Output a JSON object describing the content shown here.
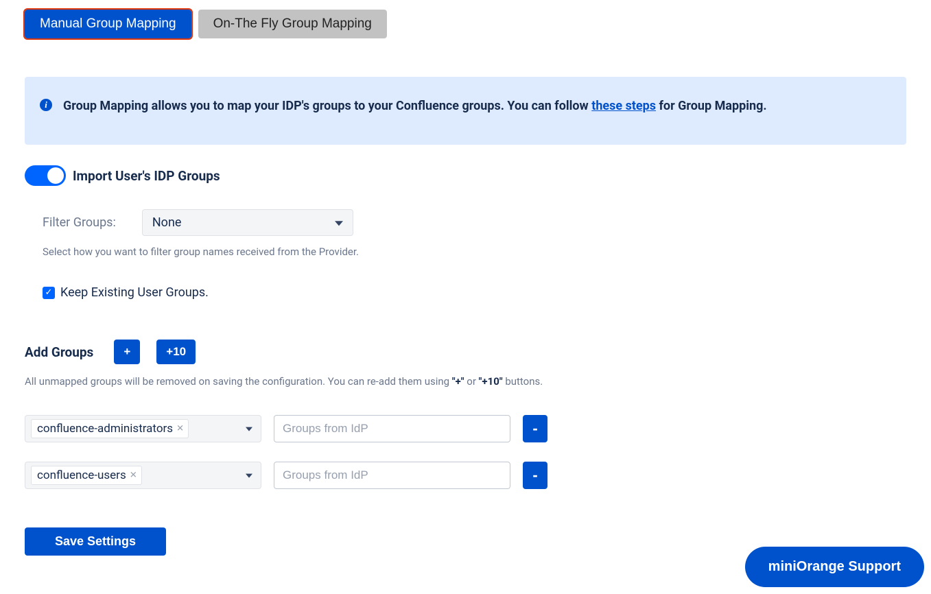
{
  "tabs": {
    "manual": "Manual Group Mapping",
    "onfly": "On-The Fly Group Mapping"
  },
  "info": {
    "text_before_link": "Group Mapping allows you to map your IDP's groups to your Confluence groups. You can follow ",
    "link_text": "these steps",
    "text_after_link": " for Group Mapping."
  },
  "toggle": {
    "label": "Import User's IDP Groups"
  },
  "filter": {
    "label": "Filter Groups:",
    "selected": "None",
    "help": "Select how you want to filter group names received from the Provider."
  },
  "keep_existing": {
    "label": "Keep Existing User Groups."
  },
  "add_groups": {
    "label": "Add Groups",
    "plus_btn": "+",
    "plus10_btn": "+10",
    "help_before": "All unmapped groups will be removed on saving the configuration. You can re-add them using ",
    "help_q1": "\"+\"",
    "help_or": " or ",
    "help_q2": "\"+10\"",
    "help_after": " buttons."
  },
  "rows": [
    {
      "group": "confluence-administrators",
      "placeholder": "Groups from IdP",
      "minus": "-"
    },
    {
      "group": "confluence-users",
      "placeholder": "Groups from IdP",
      "minus": "-"
    }
  ],
  "save_btn": "Save Settings",
  "support_btn": "miniOrange Support"
}
